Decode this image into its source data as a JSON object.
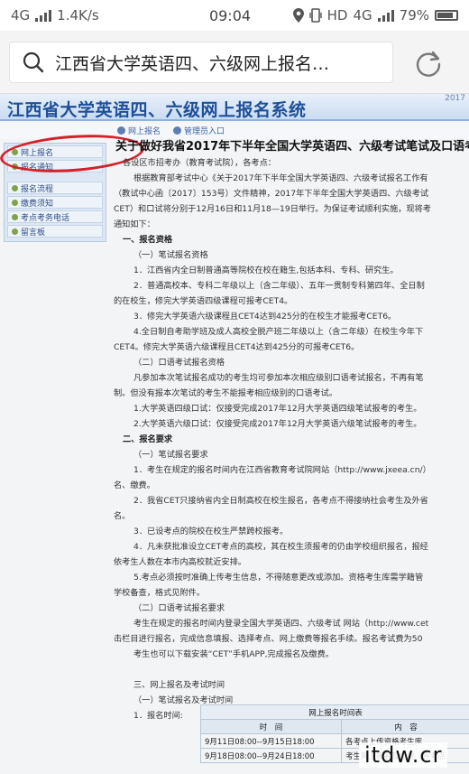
{
  "status_bar": {
    "network": "4G",
    "speed": "1.4K/s",
    "time": "09:04",
    "hd_label": "HD",
    "network_right": "4G",
    "battery": "79%"
  },
  "browser": {
    "query": "江西省大学英语四、六级网上报名…"
  },
  "site": {
    "title": "江西省大学英语四、六级网上报名系统",
    "year_tag": "2017",
    "nav": [
      "网上报名",
      "管理员入口"
    ]
  },
  "sidebar": {
    "items": [
      "网上报名",
      "报名通知",
      "报名流程",
      "缴费须知",
      "考点考务电话",
      "留言板"
    ]
  },
  "article": {
    "heading": "关于做好我省2017年下半年全国大学英语四、六级考试笔试及口语考",
    "lines": [
      {
        "t": "各设区市招考办（教育考试院），各考点：",
        "c": "ind0"
      },
      {
        "t": "根据教育部考试中心《关于2017年下半年全国大学英语四、六级考试报名工作有",
        "c": "ind1"
      },
      {
        "t": "（教试中心函〔2017〕153号）文件精神，2017年下半年全国大学英语四、六级考试",
        "c": ""
      },
      {
        "t": "CET）和口试将分别于12月16日和11月18—19日举行。为保证考试顺利实施，现将考",
        "c": ""
      },
      {
        "t": "通知如下：",
        "c": ""
      },
      {
        "t": "一、报名资格",
        "c": "ind0 b"
      },
      {
        "t": "（一）笔试报名资格",
        "c": "ind1"
      },
      {
        "t": "1．江西省内全日制普通高等院校在校在籍生,包括本科、专科、研究生。",
        "c": "ind1"
      },
      {
        "t": "2．普通高校本、专科二年级以上（含二年级）、五年一贯制专科第四年、全日制",
        "c": "ind1"
      },
      {
        "t": "的在校生，修完大学英语四级课程可报考CET4。",
        "c": ""
      },
      {
        "t": "3．修完大学英语六级课程且CET4达到425分的在校生才能报考CET6。",
        "c": "ind1"
      },
      {
        "t": "4.全日制自考助学班及成人高校全脱产班二年级以上（含二年级）在校生今年下",
        "c": "ind1"
      },
      {
        "t": "CET4。修完大学英语六级课程且CET4达到425分的可报考CET6。",
        "c": ""
      },
      {
        "t": "（二）口语考试报名资格",
        "c": "ind1"
      },
      {
        "t": "凡参加本次笔试报名成功的考生均可参加本次相应级别口语考试报名，不再有笔",
        "c": "ind1"
      },
      {
        "t": "制。但没有报本次笔试的考生不能报考相应级别的口语考试。",
        "c": ""
      },
      {
        "t": "1.大学英语四级口试：仅接受完成2017年12月大学英语四级笔试报考的考生。",
        "c": "ind1"
      },
      {
        "t": "2.大学英语六级口试：仅接受完成2017年12月大学英语六级笔试报考的考生。",
        "c": "ind1"
      },
      {
        "t": "二、报名要求",
        "c": "ind0 b"
      },
      {
        "t": "（一）笔试报名要求",
        "c": "ind1"
      },
      {
        "t": "1．考生在规定的报名时间内在江西省教育考试院网站（http://www.jxeea.cn/）",
        "c": "ind1"
      },
      {
        "t": "名、缴费。",
        "c": ""
      },
      {
        "t": "2．我省CET只接纳省内全日制高校在校生报名，各考点不得接纳社会考生及外省",
        "c": "ind1"
      },
      {
        "t": "名。",
        "c": ""
      },
      {
        "t": "3．已设考点的院校在校生严禁跨校报考。",
        "c": "ind1"
      },
      {
        "t": "4．凡未获批准设立CET考点的高校，其在校生须报考的仍由学校组织报名，报经",
        "c": "ind1"
      },
      {
        "t": "依考生人数在本市内高校就近安排。",
        "c": ""
      },
      {
        "t": "5.考点必须按时准确上传考生信息，不得随意更改或添加。资格考生库需学籍管",
        "c": "ind1"
      },
      {
        "t": "学校备查，格式见附件。",
        "c": ""
      },
      {
        "t": "（二）口语考试报名要求",
        "c": "ind1"
      },
      {
        "t": "考生在规定的报名时间内登录全国大学英语四、六级考试 网站（http://www.cet",
        "c": "ind1"
      },
      {
        "t": "击栏目进行报名，完成信息填报、选择考点、网上缴费等报名手续。报名考试费为50",
        "c": ""
      },
      {
        "t": "考生也可以下载安装“CET”手机APP,完成报名及缴费。",
        "c": "ind1"
      },
      {
        "t": "",
        "c": ""
      },
      {
        "t": "三、网上报名及考试时间",
        "c": "ind1"
      },
      {
        "t": "（一）笔试报名及考试时间",
        "c": "ind1"
      },
      {
        "t": "1．报名时间:",
        "c": "ind1"
      }
    ]
  },
  "table": {
    "caption": "网上报名时间表",
    "headers": [
      "时　间",
      "内　容"
    ],
    "rows": [
      [
        "9月11日08:00--9月15日18:00",
        "各考点上传资格考生库"
      ],
      [
        "9月18日08:00--9月24日18:00",
        "考生网上报名及缴费（各考点"
      ]
    ]
  },
  "watermark": "itdw.cr",
  "colors": {
    "banner_title": "#1e4f9a",
    "highlight_circle": "#d4202a"
  }
}
